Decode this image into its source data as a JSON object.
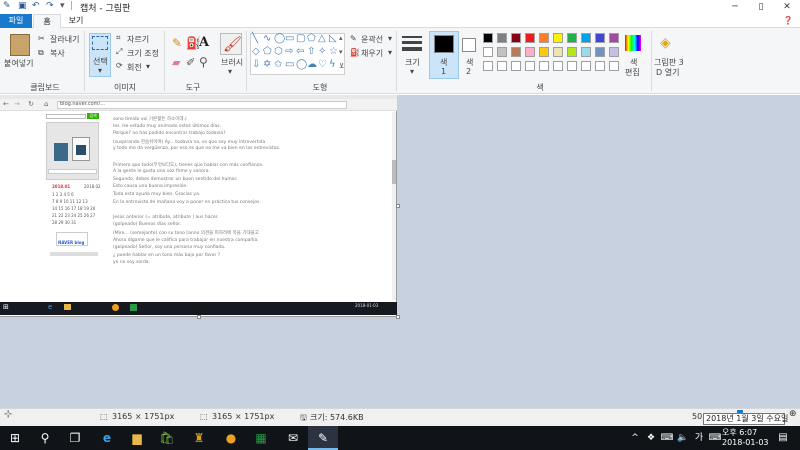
{
  "titlebar": {
    "title": "캡처 - 그림판",
    "minimize": "─",
    "maximize": "▯",
    "close": "✕"
  },
  "tabs": {
    "file": "파일",
    "home": "홈",
    "view": "보기"
  },
  "ribbon": {
    "clipboard": {
      "paste": "붙여넣기",
      "cut": "잘라내기",
      "copy": "복사",
      "label": "클립보드"
    },
    "image": {
      "select": "선택",
      "crop": "자르기",
      "resize": "크기 조정",
      "rotate": "회전",
      "label": "이미지"
    },
    "tools": {
      "label": "도구"
    },
    "brushes": {
      "label": "브러시"
    },
    "shapes": {
      "outline": "윤곽선",
      "fill": "채우기",
      "label": "도형"
    },
    "size": "크기",
    "color1": "색\n1",
    "color1_a": "색",
    "color1_b": "1",
    "color2_a": "색",
    "color2_b": "2",
    "edit_colors_a": "색",
    "edit_colors_b": "편집",
    "paint3d_a": "그림판 3",
    "paint3d_b": "D 열기",
    "colors_label": "색",
    "palette": [
      "#000000",
      "#7f7f7f",
      "#880015",
      "#ed1c24",
      "#ff7f27",
      "#fff200",
      "#22b14c",
      "#00a2e8",
      "#3f48cc",
      "#a349a4",
      "#ffffff",
      "#c3c3c3",
      "#b97a57",
      "#ffaec9",
      "#ffc90e",
      "#efe4b0",
      "#b5e61d",
      "#99d9ea",
      "#7092be",
      "#c8bfe7"
    ]
  },
  "inner": {
    "url": "blog.naver.com/...",
    "search_btn": "검색",
    "lines": [
      "sono timido voi 기본젊든 하소이데.)",
      "Ies. He estado muy animado estos últimos días.",
      "Porque? no has podido encontrar trabajo todavía?",
      "(suspirando 한숨쉬어며) Ay... todavía no, es que soy muy introvertida",
      "y todo me da vergüenza, por eso es que no me va bien en las entrevistas.",
      "",
      "Primero que todo(무엇보다도), tienes que hablar con más confianza.",
      "A la gente le gusta una voz firme y sonora.",
      "Segundo, debes demostrar un buen sentido del humor.",
      "Esto causa una buena impresión.",
      "Toda esta ayuda muy bien. Gracias ya.",
      "En la entrevista de mañana voy a poner en práctica tus consejos.",
      "",
      "Jesús anterior (= atribute, atribute ) aus hacer.",
      "(golpeado) Buenos días señor.",
      "(Mire... (semejante) con su tono [anno 의견을 피하려에 목을 기대을고",
      "Ahora digame que le califica para trabajar en nuestra compañía.",
      "(golpeado) Señor, soy una persona muy confiada.",
      "¿ puede hablar en un tono más bajo por favor ?",
      "yo no soy sorda."
    ],
    "calendar_title": "2018.01",
    "calendar_next": "2018.02",
    "calendar_rows": [
      "1 2 3 4 5 6",
      "7 8 9 10 11 12 13",
      "14 15 16 17 18 19 20",
      "21 22 23 24 25 26 27",
      "28 29 30 31"
    ],
    "naver_label": "NAVER blog"
  },
  "status": {
    "selection_size": "3165 × 1751px",
    "image_size": "3165 × 1751px",
    "file_size": "크기: 574.6KB",
    "zoom": "50"
  },
  "taskbar": {
    "time": "오후 6:07",
    "date": "2018-01-03",
    "ime": "가",
    "tooltip": "2018년 1월 3일 수요일"
  }
}
